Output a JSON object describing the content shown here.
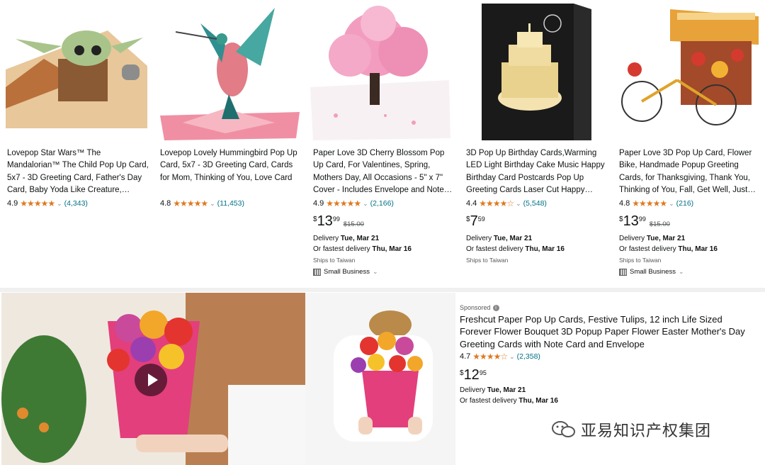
{
  "products": [
    {
      "title": "Lovepop Star Wars™ The Mandalorian™ The Child Pop Up Card, 5x7 - 3D Greeting Card, Father's Day Card, Baby Yoda Like Creature,…",
      "rating": "4.9",
      "stars": "★★★★★",
      "reviews": "(4,343)",
      "rating_value": 4.9,
      "image_icon": "baby-yoda-popup-card"
    },
    {
      "title": "Lovepop Lovely Hummingbird Pop Up Card, 5x7 - 3D Greeting Card, Cards for Mom, Thinking of You, Love Card",
      "rating": "4.8",
      "stars": "★★★★★",
      "reviews": "(11,453)",
      "rating_value": 4.8,
      "image_icon": "hummingbird-popup-card"
    },
    {
      "title": "Paper Love 3D Cherry Blossom Pop Up Card, For Valentines, Spring, Mothers Day, All Occasions - 5\" x 7\" Cover - Includes Envelope and Note…",
      "rating": "4.9",
      "stars": "★★★★★",
      "reviews": "(2,166)",
      "rating_value": 4.9,
      "price_symbol": "$",
      "price_whole": "13",
      "price_fraction": "99",
      "list_price": "$15.00",
      "delivery_label": "Delivery ",
      "delivery_date": "Tue, Mar 21",
      "fastest_label": "Or fastest delivery ",
      "fastest_date": "Thu, Mar 16",
      "ships": "Ships to Taiwan",
      "badge": "Small Business",
      "image_icon": "cherry-blossom-popup-card"
    },
    {
      "title": "3D Pop Up Birthday Cards,Warming LED Light Birthday Cake Music Happy Birthday Card Postcards Pop Up Greeting Cards Laser Cut Happy…",
      "rating": "4.4",
      "stars": "★★★★☆",
      "reviews": "(5,548)",
      "rating_value": 4.4,
      "price_symbol": "$",
      "price_whole": "7",
      "price_fraction": "59",
      "delivery_label": "Delivery ",
      "delivery_date": "Tue, Mar 21",
      "fastest_label": "Or fastest delivery ",
      "fastest_date": "Thu, Mar 16",
      "ships": "Ships to Taiwan",
      "image_icon": "birthday-cake-popup-card"
    },
    {
      "title": "Paper Love 3D Pop Up Card, Flower Bike, Handmade Popup Greeting Cards, for Thanksgiving, Thank You, Thinking of You, Fall, Get Well, Just…",
      "rating": "4.8",
      "stars": "★★★★★",
      "reviews": "(216)",
      "rating_value": 4.8,
      "price_symbol": "$",
      "price_whole": "13",
      "price_fraction": "99",
      "list_price": "$15.00",
      "delivery_label": "Delivery ",
      "delivery_date": "Tue, Mar 21",
      "fastest_label": "Or fastest delivery ",
      "fastest_date": "Thu, Mar 16",
      "ships": "Ships to Taiwan",
      "badge": "Small Business",
      "image_icon": "flower-bike-popup-card"
    }
  ],
  "sponsored": {
    "label": "Sponsored",
    "info_icon": "i",
    "title": "Freshcut Paper Pop Up Cards, Festive Tulips, 12 inch Life Sized Forever Flower Bouquet 3D Popup Paper Flower Easter Mother's Day Greeting Cards with Note Card and Envelope",
    "rating": "4.7",
    "stars": "★★★★☆",
    "reviews": "(2,358)",
    "rating_value": 4.7,
    "price_symbol": "$",
    "price_whole": "12",
    "price_fraction": "95",
    "delivery_label": "Delivery ",
    "delivery_date": "Tue, Mar 21",
    "fastest_label": "Or fastest delivery ",
    "fastest_date": "Thu, Mar 16",
    "video_icon": "play-icon"
  },
  "watermark": {
    "text": "亚易知识产权集团",
    "logo": "wechat-logo"
  },
  "colors": {
    "star": "#de7921",
    "link": "#007185",
    "muted": "#565959",
    "text": "#0f1111"
  }
}
